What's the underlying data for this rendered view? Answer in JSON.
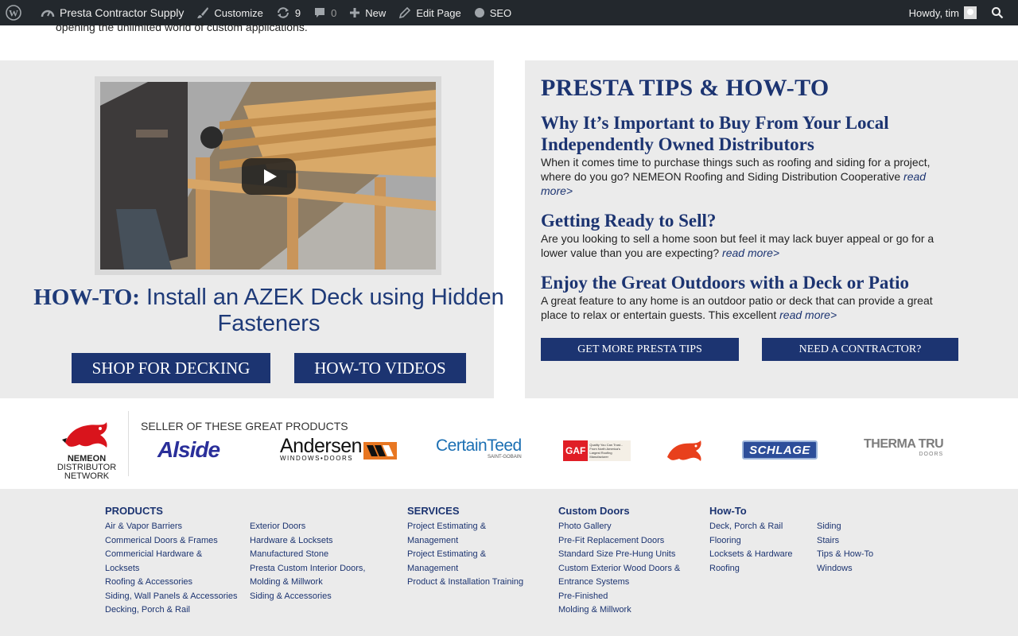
{
  "admin_bar": {
    "site_name": "Presta Contractor Supply",
    "customize": "Customize",
    "updates_count": "9",
    "comments_count": "0",
    "new": "New",
    "edit_page": "Edit Page",
    "seo": "SEO",
    "howdy": "Howdy, tim"
  },
  "intro_text": "opening the unlimited world of custom applications.",
  "feature": {
    "title_prefix": "HOW-TO:",
    "title_rest": "Install an AZEK Deck using Hidden Fasteners",
    "shop_button": "SHOP FOR DECKING",
    "videos_button": "HOW-TO VIDEOS"
  },
  "tips": {
    "heading": "PRESTA TIPS & HOW-TO",
    "items": [
      {
        "title": "Why It’s Important to Buy From Your Local Independently Owned Distributors",
        "body": "When it comes time to purchase things such as roofing and siding for a project, where do you go? NEMEON Roofing and Siding Distribution Cooperative",
        "link": "read more>"
      },
      {
        "title": "Getting Ready to Sell?",
        "body": "Are you looking to sell a home soon but feel it may lack buyer appeal or go for a lower value than you are expecting?",
        "link": "read more>"
      },
      {
        "title": "Enjoy the Great Outdoors with a Deck or Patio",
        "body": "A great feature to any home is an outdoor patio or deck that can provide a great place to relax or entertain guests. This excellent",
        "link": "read more>"
      }
    ],
    "more_tips_button": "GET MORE PRESTA TIPS",
    "contractor_button": "NEED A CONTRACTOR?"
  },
  "brands": {
    "nemeon_name": "NEMEON",
    "nemeon_sub1": "DISTRIBUTOR",
    "nemeon_sub2": "NETWORK",
    "seller_label": "SELLER OF THESE GREAT PRODUCTS",
    "alside": "Alside",
    "andersen": "Andersen",
    "andersen_sub": "WINDOWS•DOORS",
    "certainteed": "CertainTeed",
    "certainteed_sub": "SAINT-GOBAIN",
    "gaf": "GAF",
    "gaf_tag": "Quality You Can Trust... From North America's Largest Roofing Manufacturer",
    "schlage": "SCHLAGE",
    "thermatru": "THERMA TRU",
    "thermatru_sub": "DOORS"
  },
  "footer": {
    "products": {
      "heading": "PRODUCTS",
      "col1": [
        "Air & Vapor Barriers",
        "Commerical Doors & Frames",
        "Commericial Hardware &",
        "Locksets",
        "Roofing & Accessories",
        "Siding, Wall Panels & Accessories",
        "Decking, Porch & Rail"
      ],
      "col2": [
        "Exterior Doors",
        "Hardware & Locksets",
        "Manufactured Stone",
        "Presta Custom Interior Doors,",
        "Molding & Millwork",
        "Siding & Accessories"
      ]
    },
    "services": {
      "heading": "SERVICES",
      "items": [
        "Project Estimating &",
        "Management",
        "Project Estimating &",
        "Management",
        "Product & Installation Training"
      ]
    },
    "custom_doors": {
      "heading": "Custom Doors",
      "items": [
        "Photo Gallery",
        "Pre-Fit Replacement Doors",
        "Standard Size Pre-Hung Units",
        "Custom Exterior Wood Doors &",
        "Entrance Systems",
        "Pre-Finished",
        "Molding & Millwork"
      ]
    },
    "howto": {
      "heading": "How-To",
      "col1": [
        "Deck, Porch & Rail",
        "Flooring",
        "Locksets & Hardware",
        "Roofing"
      ],
      "col2": [
        "Siding",
        "Stairs",
        "Tips & How-To",
        "Windows"
      ]
    }
  }
}
